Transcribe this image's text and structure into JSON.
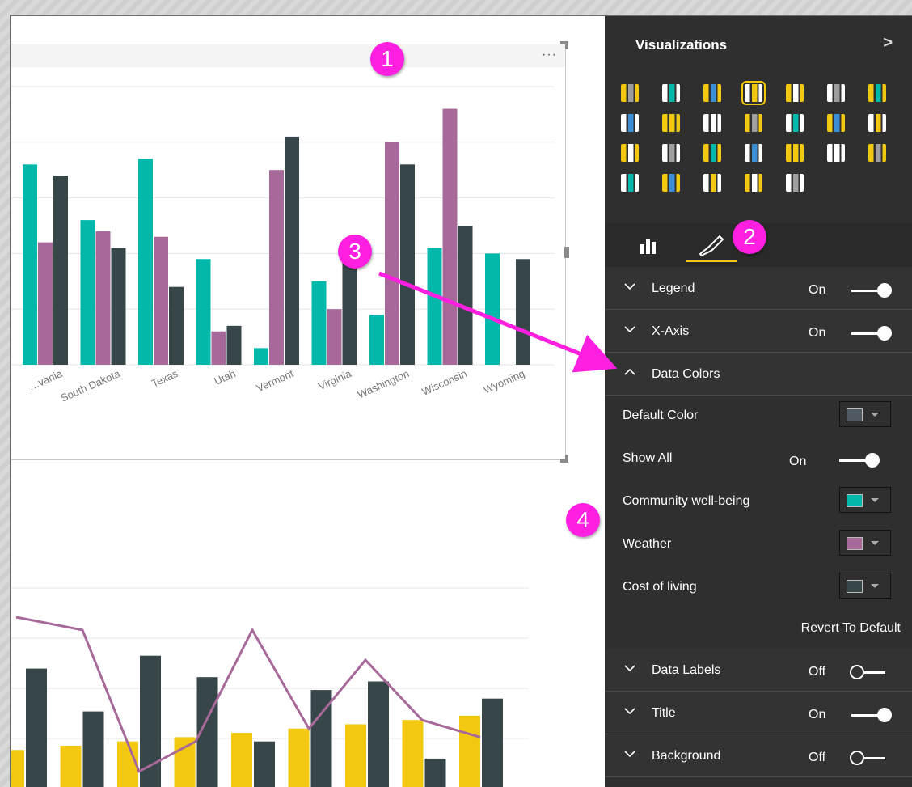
{
  "pane": {
    "title": "Visualizations",
    "collapse_icon": "chevron-right-icon"
  },
  "visual_icons": [
    "stacked-bar",
    "stacked-column",
    "clustered-bar",
    "clustered-column",
    "100pct-bar",
    "100pct-column",
    "line",
    "area",
    "stacked-area",
    "line-clustered-column",
    "line-stacked-column",
    "ribbon",
    "waterfall",
    "scatter",
    "pie",
    "treemap",
    "map",
    "table",
    "matrix",
    "filled-map",
    "funnel",
    "gauge",
    "multi-row-card",
    "card",
    "slicer",
    "donut"
  ],
  "sections": [
    {
      "title": "Legend",
      "state": "On",
      "expanded": false
    },
    {
      "title": "X-Axis",
      "state": "On",
      "expanded": false
    },
    {
      "title": "Data Colors",
      "state": "",
      "expanded": true
    },
    {
      "title": "Data Labels",
      "state": "Off",
      "expanded": false
    },
    {
      "title": "Title",
      "state": "On",
      "expanded": false
    },
    {
      "title": "Background",
      "state": "Off",
      "expanded": false
    }
  ],
  "data_colors": {
    "default_color_label": "Default Color",
    "default_color": "#4e5a5f",
    "show_all_label": "Show All",
    "show_all_state": "On",
    "series": [
      {
        "label": "Community well-being",
        "color": "#01b8aa"
      },
      {
        "label": "Weather",
        "color": "#a66999"
      },
      {
        "label": "Cost of living",
        "color": "#374649"
      }
    ],
    "revert_label": "Revert To Default"
  },
  "badges": [
    "1",
    "2",
    "3",
    "4"
  ],
  "colors": {
    "accent": "#f2c811",
    "badge": "#ff1fe0",
    "pane_bg": "#2f2f2f"
  },
  "chart_data": [
    {
      "type": "bar",
      "categories": [
        "…vania",
        "South Dakota",
        "Texas",
        "Utah",
        "Vermont",
        "Virginia",
        "Washington",
        "Wisconsin",
        "Wyoming"
      ],
      "series": [
        {
          "name": "Community well-being",
          "color": "#01b8aa",
          "values": [
            36,
            26,
            37,
            19,
            3,
            15,
            9,
            21,
            20
          ]
        },
        {
          "name": "Weather",
          "color": "#a66999",
          "values": [
            22,
            24,
            23,
            6,
            35,
            10,
            40,
            46,
            null
          ]
        },
        {
          "name": "Cost of living",
          "color": "#374649",
          "values": [
            34,
            21,
            14,
            7,
            41,
            20,
            36,
            25,
            19
          ]
        }
      ],
      "ylim": [
        0,
        50
      ],
      "grid": true
    },
    {
      "type": "bar",
      "series": [
        {
          "color": "#f2c811",
          "values": [
            9,
            10,
            11,
            12,
            13,
            14,
            15,
            16,
            17
          ]
        },
        {
          "color": "#374649",
          "values": [
            28,
            18,
            31,
            26,
            11,
            23,
            25,
            7,
            21
          ]
        },
        {
          "type": "line",
          "color": "#a66999",
          "values": [
            40,
            37,
            4,
            11,
            37,
            14,
            30,
            16,
            12
          ]
        }
      ],
      "ylim": [
        0,
        50
      ],
      "grid": true
    }
  ]
}
